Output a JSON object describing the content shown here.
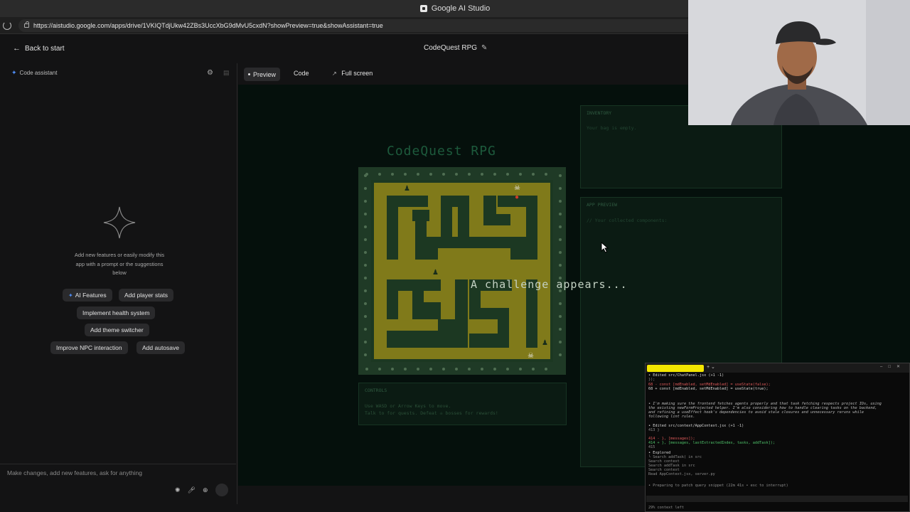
{
  "window": {
    "title": "Google AI Studio"
  },
  "browser": {
    "url": "https://aistudio.google.com/apps/drive/1VKIQTdjUkw42ZBs3UccXbG9dMvU5cxdN?showPreview=true&showAssistant=true"
  },
  "header": {
    "back_label": "Back to start",
    "app_title": "CodeQuest RPG"
  },
  "assistant": {
    "label": "Code assistant",
    "help_text": "Add new features or easily modify this app with a prompt or the suggestions below",
    "chips": [
      "AI Features",
      "Add player stats",
      "Implement health system",
      "Add theme switcher",
      "Improve NPC interaction",
      "Add autosave"
    ],
    "prompt_placeholder": "Make changes, add new features, ask for anything"
  },
  "tabs": {
    "preview": "Preview",
    "code": "Code",
    "fullscreen": "Full screen"
  },
  "game": {
    "title": "CodeQuest RPG",
    "challenge_text": "A challenge appears...",
    "controls_title": "CONTROLS",
    "controls_line1": "Use WASD or Arrow Keys to move.",
    "controls_line2": "Talk to   for quests. Defeat ☠ bosses for rewards!",
    "inventory_title": "INVENTORY",
    "inventory_empty": "Your bag is empty.",
    "app_preview_title": "APP PREVIEW",
    "app_preview_code": "// Your collected components:"
  },
  "terminal": {
    "lines": [
      {
        "text": "• Edited src/ChatPanel.jsx (+1 -1)",
        "style": ""
      },
      {
        "text": "      });",
        "style": "dim"
      },
      {
        "text": "  68 -  const [mdEnabled, setMdEnabled] = useState(false);",
        "style": "red"
      },
      {
        "text": "  68 +  const [mdEnabled, setMdEnabled] = useState(true);",
        "style": ""
      },
      {
        "text": "• I'm making sure the frontend fetches agents properly and that task fetching respects project IDs, using",
        "style": "ital"
      },
      {
        "text": "  the existing newFormProjected helper. I'm also considering how to handle clearing tasks on the backend,",
        "style": "ital"
      },
      {
        "text": "  and refining a useEffect hook's dependencies to avoid stale closures and unnecessary reruns while",
        "style": "ital"
      },
      {
        "text": "  following lint rules.",
        "style": "ital"
      },
      {
        "text": "• Edited src/context/AppContext.jsx (+1 -1)",
        "style": ""
      },
      {
        "text": "  413      }",
        "style": "dim"
      },
      {
        "text": "  414 -    }, [messages]);",
        "style": "red"
      },
      {
        "text": "  414 +    }, [messages, lastExtractedIndex, tasks, addTask]);",
        "style": "grn"
      },
      {
        "text": "  415",
        "style": "dim"
      },
      {
        "text": "• Explored",
        "style": ""
      },
      {
        "text": "  └ Search addTask( in src",
        "style": "dim"
      },
      {
        "text": "    Search context",
        "style": "dim"
      },
      {
        "text": "    Search addTask in src",
        "style": "dim"
      },
      {
        "text": "    Search context",
        "style": "dim"
      },
      {
        "text": "    Read AppContext.jsx, server.py",
        "style": "dim"
      },
      {
        "text": "• Preparing to patch query snippet (22m 41s • esc to interrupt)",
        "style": "dim"
      },
      {
        "text": "› we are cookin",
        "style": ""
      },
      {
        "text": "  29% context left",
        "style": "dim"
      }
    ]
  },
  "colors": {
    "accent": "#4f8ef7",
    "maze_floor": "#807a1a",
    "maze_wall": "#1c3822",
    "preview_bg": "#05100c"
  }
}
